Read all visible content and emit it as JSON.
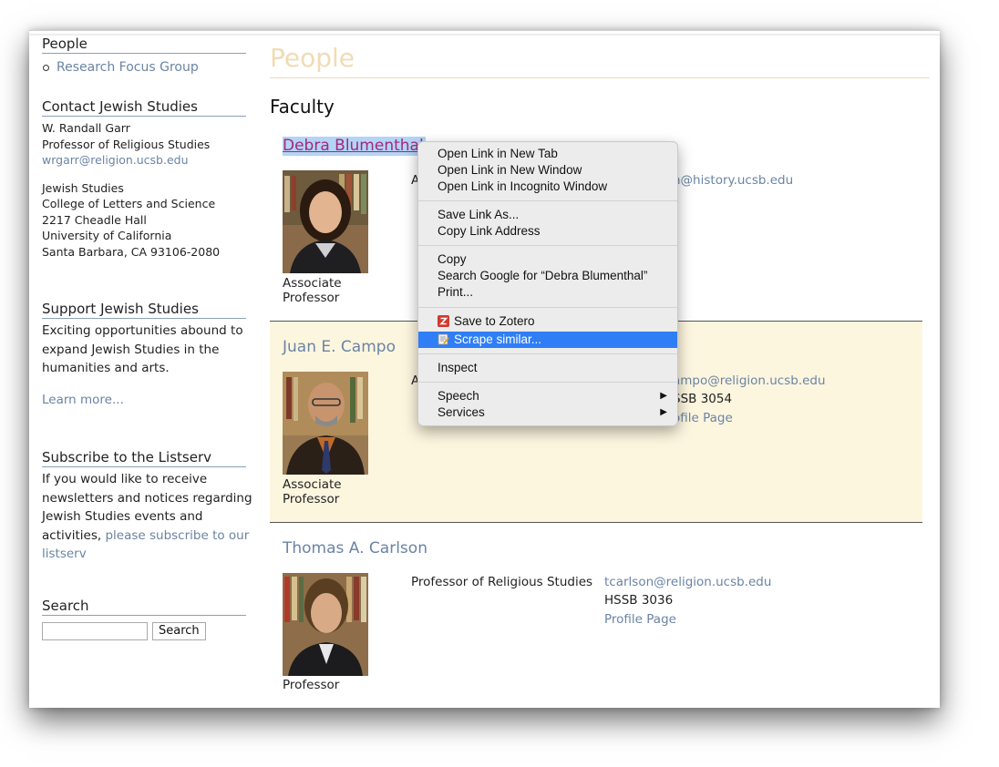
{
  "sidebar": {
    "people_heading": "People",
    "research_focus_link": "Research Focus Group",
    "contact_heading": "Contact Jewish Studies",
    "contact_name": "W. Randall Garr",
    "contact_title": "Professor of Religious Studies",
    "contact_email": "wrgarr@religion.ucsb.edu",
    "address": [
      "Jewish Studies",
      "College of Letters and Science",
      "2217 Cheadle Hall",
      "University of California",
      "Santa Barbara, CA 93106-2080"
    ],
    "support_heading": "Support Jewish Studies",
    "support_text": [
      "Exciting opportunities abound to",
      "expand Jewish Studies in the",
      "humanities and arts."
    ],
    "learn_more": "Learn more...",
    "subscribe_heading": "Subscribe to the Listserv",
    "subscribe_text": [
      "If you would like to receive",
      "newsletters and notices regarding",
      "Jewish Studies events and"
    ],
    "subscribe_text_prefix": "activities, ",
    "subscribe_link_1": "please subscribe to our",
    "subscribe_link_2": "listserv",
    "search_heading": "Search",
    "search_value": "",
    "search_button": "Search"
  },
  "main": {
    "page_title": "People",
    "section_title": "Faculty",
    "faculty": [
      {
        "name": "Debra Blumenthal",
        "rank": [
          "Associate",
          "Professor"
        ],
        "role": "A",
        "email": "n@history.ucsb.edu",
        "room": "",
        "profile": ""
      },
      {
        "name": "Juan E. Campo",
        "rank": [
          "Associate",
          "Professor"
        ],
        "role": "A",
        "email": "ampo@religion.ucsb.edu",
        "room": "SSB 3054",
        "profile": "ofile Page"
      },
      {
        "name": "Thomas A. Carlson",
        "rank": [
          "Professor"
        ],
        "role": "Professor of Religious Studies",
        "email": "tcarlson@religion.ucsb.edu",
        "room": "HSSB 3036",
        "profile": "Profile Page"
      }
    ]
  },
  "context_menu": {
    "items": [
      "Open Link in New Tab",
      "Open Link in New Window",
      "Open Link in Incognito Window",
      "Save Link As...",
      "Copy Link Address",
      "Copy",
      "Search Google for “Debra Blumenthal”",
      "Print...",
      "Save to Zotero",
      "Scrape similar...",
      "Inspect",
      "Speech",
      "Services"
    ],
    "highlighted": "Scrape similar..."
  },
  "colors": {
    "link": "#6a84a4",
    "title": "#f0dcb4",
    "alt_row_bg": "#fdf6df",
    "selection_bg": "#b4d4f6",
    "menu_highlight": "#2f7ef6"
  },
  "icons": [
    "zotero-icon",
    "scraper-icon",
    "submenu-arrow-icon"
  ]
}
